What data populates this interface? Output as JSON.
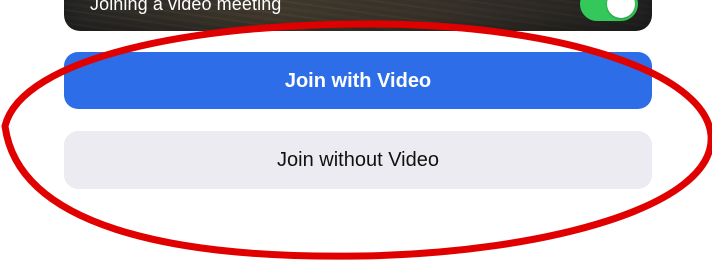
{
  "preview": {
    "caption": "Joining a video meeting",
    "video_toggle": "on",
    "toggle_color": "#34c759"
  },
  "actions": {
    "join_with_video": "Join with Video",
    "join_without_video": "Join without Video"
  },
  "colors": {
    "primary_button": "#2d6ee8",
    "secondary_button": "#ecebf1",
    "annotation_ring": "#e00000"
  }
}
